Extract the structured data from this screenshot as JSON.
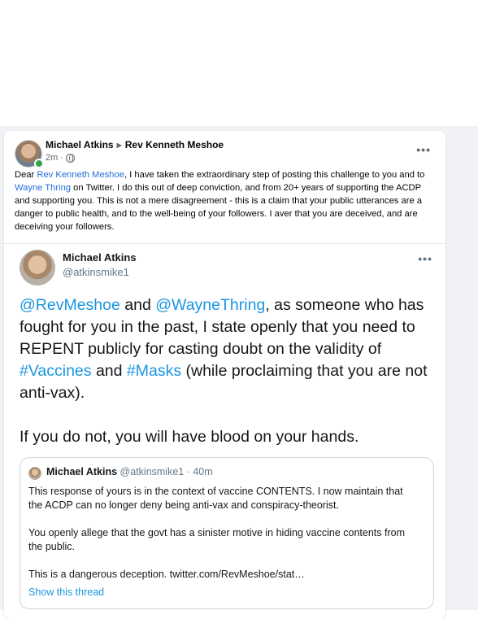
{
  "post": {
    "author": "Michael Atkins",
    "recipient": "Rev Kenneth Meshoe",
    "time": "2m",
    "meta_sep": "·",
    "text": {
      "p1": "Dear ",
      "link1": "Rev Kenneth Meshoe",
      "p2": ", I have taken the extraordinary step of posting this challenge to you and to ",
      "link2": "Wayne Thring",
      "p3": " on Twitter. I do this out of deep conviction, and from 20+ years of supporting the ACDP and supporting you. This is not a mere disagreement - this is a claim that your public utterances are a danger to public health, and to the well-being of your followers. I aver that you are deceived, and are deceiving your followers."
    }
  },
  "tweet": {
    "name": "Michael Atkins",
    "handle": "@atkinsmike1",
    "body": {
      "mention1": "@RevMeshoe",
      "t1": " and ",
      "mention2": "@WayneThring",
      "t2": ", as someone who has fought for you in the past, I state openly that you need to REPENT publicly for casting doubt on the validity of ",
      "tag1": "#Vaccines",
      "t3": " and ",
      "tag2": "#Masks",
      "t4": " (while proclaiming that you are not anti-vax).",
      "second": "If you do not, you will have blood on your hands."
    },
    "quote": {
      "name": "Michael Atkins",
      "handle": "@atkinsmike1",
      "time": " · 40m",
      "p1": "This response of yours is in the context of vaccine CONTENTS. I now maintain that the ACDP can no longer deny being anti-vax and conspiracy-theorist.",
      "p2": "You openly allege that the govt has a sinister motive in hiding vaccine contents from the public.",
      "p3": "This is a dangerous deception. twitter.com/RevMeshoe/stat…",
      "show_thread": "Show this thread"
    }
  },
  "icons": {
    "more": "more-options-icon",
    "audience": "globe-icon",
    "arrow": "caret-right-icon"
  },
  "colors": {
    "facebook_link": "#216fdb",
    "twitter_link": "#1b95e0",
    "online": "#31a24c"
  }
}
